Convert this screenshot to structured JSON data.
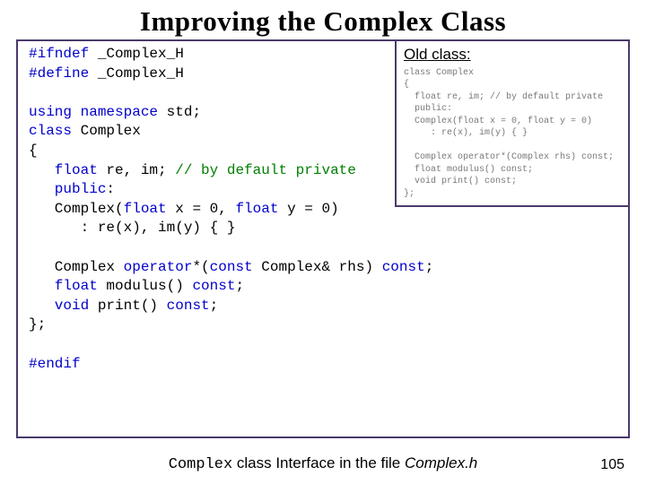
{
  "title": "Improving the Complex Class",
  "code": {
    "l1a": "#ifndef",
    "l1b": " _Complex_H",
    "l2a": "#define",
    "l2b": " _Complex_H",
    "l3a": "using namespace",
    "l3b": " std;",
    "l4a": "class ",
    "l4b": "Complex",
    "l5": "{",
    "l6a": "   float",
    "l6b": " re, im; ",
    "l6c": "// by default private",
    "l7a": "   public",
    "l7b": ":",
    "l8a": "   Complex(",
    "l8b": "float",
    "l8c": " x = 0, ",
    "l8d": "float",
    "l8e": " y = 0)",
    "l9": "      : re(x), im(y) { }",
    "l10a": "   Complex ",
    "l10b": "operator",
    "l10c": "*(",
    "l10d": "const",
    "l10e": " Complex& rhs) ",
    "l10f": "const",
    "l10g": ";",
    "l11a": "   float",
    "l11b": " modulus() ",
    "l11c": "const",
    "l11d": ";",
    "l12a": "   void",
    "l12b": " print() ",
    "l12c": "const",
    "l12d": ";",
    "l13": "};",
    "l14": "#endif"
  },
  "old": {
    "title": "Old class:",
    "c1": "class Complex",
    "c2": "{",
    "c3": "  float re, im; // by default private",
    "c4": "  public:",
    "c5": "  Complex(float x = 0, float y = 0)",
    "c6": "     : re(x), im(y) { }",
    "c7": "  Complex operator*(Complex rhs) const;",
    "c8": "  float modulus() const;",
    "c9": "  void print() const;",
    "c10": "};"
  },
  "caption": {
    "p1": "Complex",
    "p2": " class Interface in the file ",
    "p3": "Complex.h"
  },
  "page": "105"
}
